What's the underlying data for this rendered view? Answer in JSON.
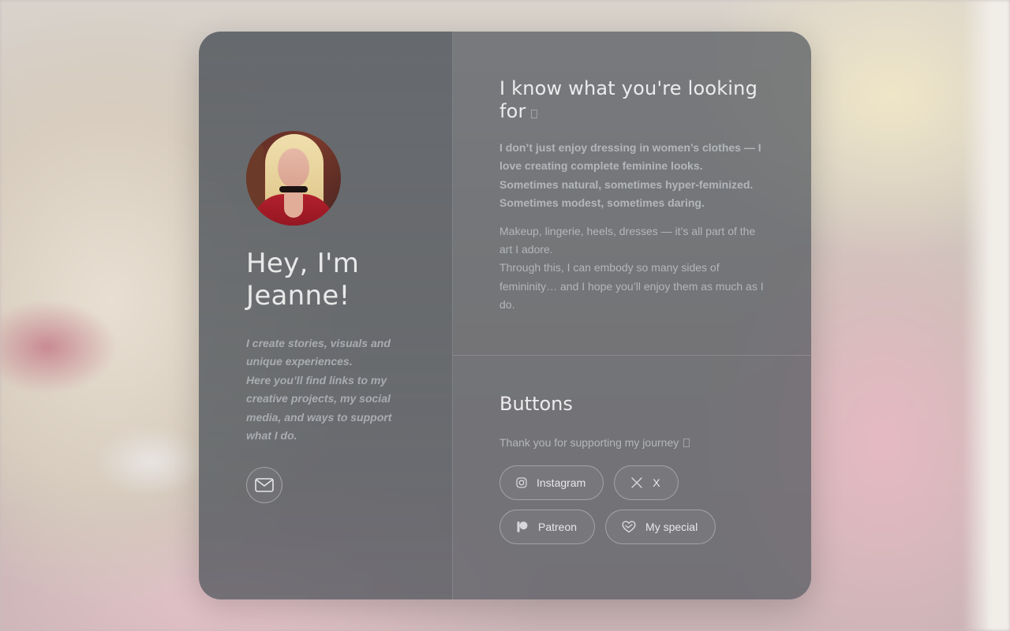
{
  "profile": {
    "title": "Hey, I'm Jeanne!",
    "bio_line1": "I create stories, visuals and unique experiences.",
    "bio_line2": "Here you’ll find links to my creative projects, my social media, and ways to support what I do.",
    "contact_icon": "envelope-icon"
  },
  "about": {
    "title": "I know what you're looking for",
    "lead": "I don’t just enjoy dressing in women’s clothes — I love creating complete feminine looks. Sometimes natural, sometimes hyper-feminized. Sometimes modest, sometimes daring.",
    "body_line1": "Makeup, lingerie, heels, dresses — it’s all part of the art I adore.",
    "body_line2": "Through this, I can embody so many sides of femininity… and I hope you’ll enjoy them as much as I do."
  },
  "buttons": {
    "title": "Buttons",
    "subtitle": "Thank you for supporting my journey",
    "items": [
      {
        "label": "Instagram",
        "icon": "instagram-icon"
      },
      {
        "label": "X",
        "icon": "x-icon"
      },
      {
        "label": "Patreon",
        "icon": "patreon-icon"
      },
      {
        "label": "My special",
        "icon": "heart-icon"
      }
    ]
  }
}
